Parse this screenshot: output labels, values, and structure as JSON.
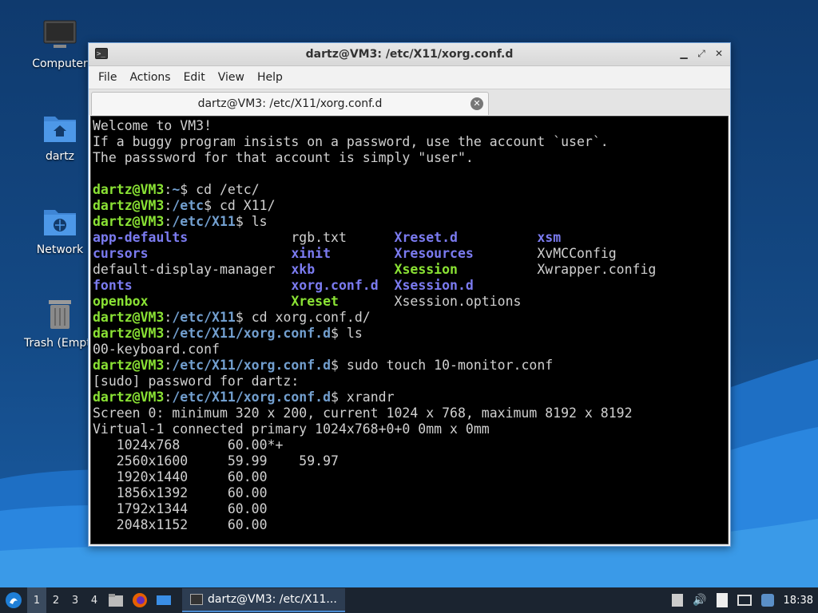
{
  "desktop": {
    "icons": [
      {
        "label": "Computer"
      },
      {
        "label": "dartz"
      },
      {
        "label": "Network"
      },
      {
        "label": "Trash (Empty)"
      }
    ]
  },
  "window": {
    "title": "dartz@VM3: /etc/X11/xorg.conf.d",
    "menu": [
      "File",
      "Actions",
      "Edit",
      "View",
      "Help"
    ],
    "tab_title": "dartz@VM3: /etc/X11/xorg.conf.d"
  },
  "terminal": {
    "welcome": [
      "Welcome to VM3!",
      "If a buggy program insists on a password, use the account `user`.",
      "The passsword for that account is simply \"user\"."
    ],
    "user": "dartz@VM3",
    "cmds": [
      {
        "path": "~",
        "cmd": "cd /etc/"
      },
      {
        "path": "/etc",
        "cmd": "cd X11/"
      },
      {
        "path": "/etc/X11",
        "cmd": "ls"
      },
      {
        "path": "/etc/X11",
        "cmd": "cd xorg.conf.d/"
      },
      {
        "path": "/etc/X11/xorg.conf.d",
        "cmd": "ls"
      },
      {
        "path": "/etc/X11/xorg.conf.d",
        "cmd": "sudo touch 10-monitor.conf"
      },
      {
        "path": "/etc/X11/xorg.conf.d",
        "cmd": "xrandr"
      }
    ],
    "ls_x11": [
      [
        "app-defaults",
        "rgb.txt",
        "Xreset.d",
        "xsm"
      ],
      [
        "cursors",
        "xinit",
        "Xresources",
        "XvMCConfig"
      ],
      [
        "default-display-manager",
        "xkb",
        "Xsession",
        "Xwrapper.config"
      ],
      [
        "fonts",
        "xorg.conf.d",
        "Xsession.d",
        ""
      ],
      [
        "openbox",
        "Xreset",
        "Xsession.options",
        ""
      ]
    ],
    "ls_xorg": "00-keyboard.conf",
    "sudo_prompt": "[sudo] password for dartz:",
    "xrandr_screen": "Screen 0: minimum 320 x 200, current 1024 x 768, maximum 8192 x 8192",
    "xrandr_output": "Virtual-1 connected primary 1024x768+0+0 0mm x 0mm",
    "modes": [
      {
        "res": "1024x768",
        "rates": "60.00*+"
      },
      {
        "res": "2560x1600",
        "rates": "59.99    59.97"
      },
      {
        "res": "1920x1440",
        "rates": "60.00"
      },
      {
        "res": "1856x1392",
        "rates": "60.00"
      },
      {
        "res": "1792x1344",
        "rates": "60.00"
      },
      {
        "res": "2048x1152",
        "rates": "60.00"
      }
    ]
  },
  "taskbar": {
    "workspaces": [
      "1",
      "2",
      "3",
      "4"
    ],
    "task_label": "dartz@VM3: /etc/X11...",
    "clock": "18:38"
  }
}
